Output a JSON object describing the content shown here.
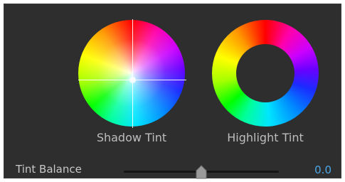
{
  "wheels": {
    "shadow_label": "Shadow Tint",
    "highlight_label": "Highlight Tint"
  },
  "tint_balance": {
    "label": "Tint Balance",
    "value": "0.0",
    "position_fraction": 0.5
  },
  "colors": {
    "panel_bg": "#2e2e2e",
    "label_text": "#bdbdbd",
    "value_accent": "#4aa8e8",
    "slider_track": "#151515",
    "slider_thumb": "#9a9a9a"
  },
  "icons": {
    "crosshair": "crosshair-icon",
    "slider_thumb": "slider-thumb-icon"
  }
}
